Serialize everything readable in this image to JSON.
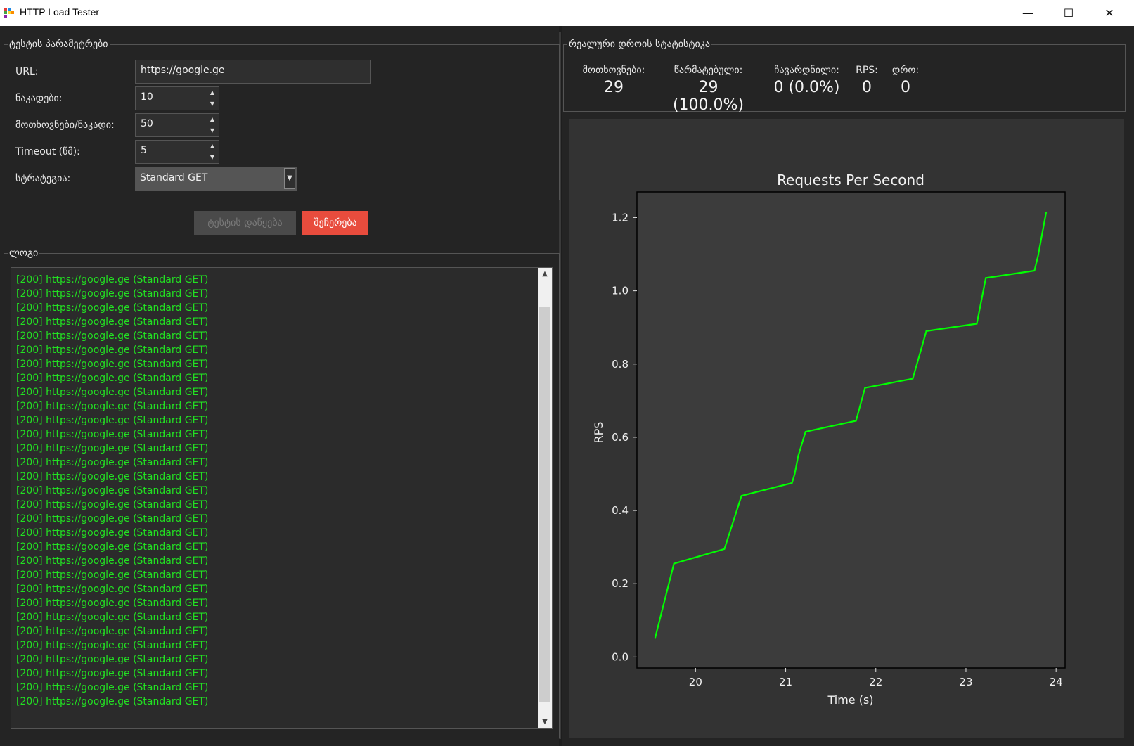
{
  "window": {
    "title": "HTTP Load Tester",
    "minimize": "—",
    "maximize": "☐",
    "close": "✕"
  },
  "params": {
    "group_title": "ტესტის პარამეტრები",
    "url_label": "URL:",
    "url_value": "https://google.ge",
    "threads_label": "ნაკადები:",
    "threads_value": "10",
    "requests_label": "მოთხოვნები/ნაკადი:",
    "requests_value": "50",
    "timeout_label": "Timeout (წმ):",
    "timeout_value": "5",
    "strategy_label": "სტრატეგია:",
    "strategy_value": "Standard GET"
  },
  "actions": {
    "start_label": "ტესტის დაწყება",
    "stop_label": "შეჩერება"
  },
  "log": {
    "group_title": "ლოგი",
    "lines": [
      "[200] https://google.ge (Standard GET)",
      "[200] https://google.ge (Standard GET)",
      "[200] https://google.ge (Standard GET)",
      "[200] https://google.ge (Standard GET)",
      "[200] https://google.ge (Standard GET)",
      "[200] https://google.ge (Standard GET)",
      "[200] https://google.ge (Standard GET)",
      "[200] https://google.ge (Standard GET)",
      "[200] https://google.ge (Standard GET)",
      "[200] https://google.ge (Standard GET)",
      "[200] https://google.ge (Standard GET)",
      "[200] https://google.ge (Standard GET)",
      "[200] https://google.ge (Standard GET)",
      "[200] https://google.ge (Standard GET)",
      "[200] https://google.ge (Standard GET)",
      "[200] https://google.ge (Standard GET)",
      "[200] https://google.ge (Standard GET)",
      "[200] https://google.ge (Standard GET)",
      "[200] https://google.ge (Standard GET)",
      "[200] https://google.ge (Standard GET)",
      "[200] https://google.ge (Standard GET)",
      "[200] https://google.ge (Standard GET)",
      "[200] https://google.ge (Standard GET)",
      "[200] https://google.ge (Standard GET)",
      "[200] https://google.ge (Standard GET)",
      "[200] https://google.ge (Standard GET)",
      "[200] https://google.ge (Standard GET)",
      "[200] https://google.ge (Standard GET)",
      "[200] https://google.ge (Standard GET)",
      "[200] https://google.ge (Standard GET)",
      "[200] https://google.ge (Standard GET)"
    ]
  },
  "stats": {
    "group_title": "რეალური დროის სტატისტიკა",
    "requests_label": "მოთხოვნები:",
    "requests_value": "29",
    "success_label": "წარმატებული:",
    "success_value": "29 (100.0%)",
    "failed_label": "ჩავარდნილი:",
    "failed_value": "0 (0.0%)",
    "rps_label": "RPS:",
    "rps_value": "0",
    "time_label": "დრო:",
    "time_value": "0"
  },
  "chart_data": {
    "type": "line",
    "title": "Requests Per Second",
    "xlabel": "Time (s)",
    "ylabel": "RPS",
    "xlim": [
      19.35,
      24.1
    ],
    "ylim": [
      -0.03,
      1.27
    ],
    "xticks": [
      "20",
      "21",
      "22",
      "23",
      "24"
    ],
    "yticks": [
      "0.0",
      "0.2",
      "0.4",
      "0.6",
      "0.8",
      "1.0",
      "1.2"
    ],
    "line_color": "#00ff00",
    "grid": false,
    "series": [
      {
        "x": [
          19.55,
          19.76,
          20.32,
          20.51,
          21.07,
          21.1,
          21.14,
          21.22,
          21.78,
          21.88,
          22.41,
          22.56,
          23.12,
          23.22,
          23.76,
          23.8,
          23.89
        ],
        "y": [
          0.05,
          0.255,
          0.295,
          0.44,
          0.475,
          0.5,
          0.55,
          0.615,
          0.645,
          0.735,
          0.76,
          0.89,
          0.91,
          1.035,
          1.055,
          1.095,
          1.215
        ]
      }
    ]
  }
}
